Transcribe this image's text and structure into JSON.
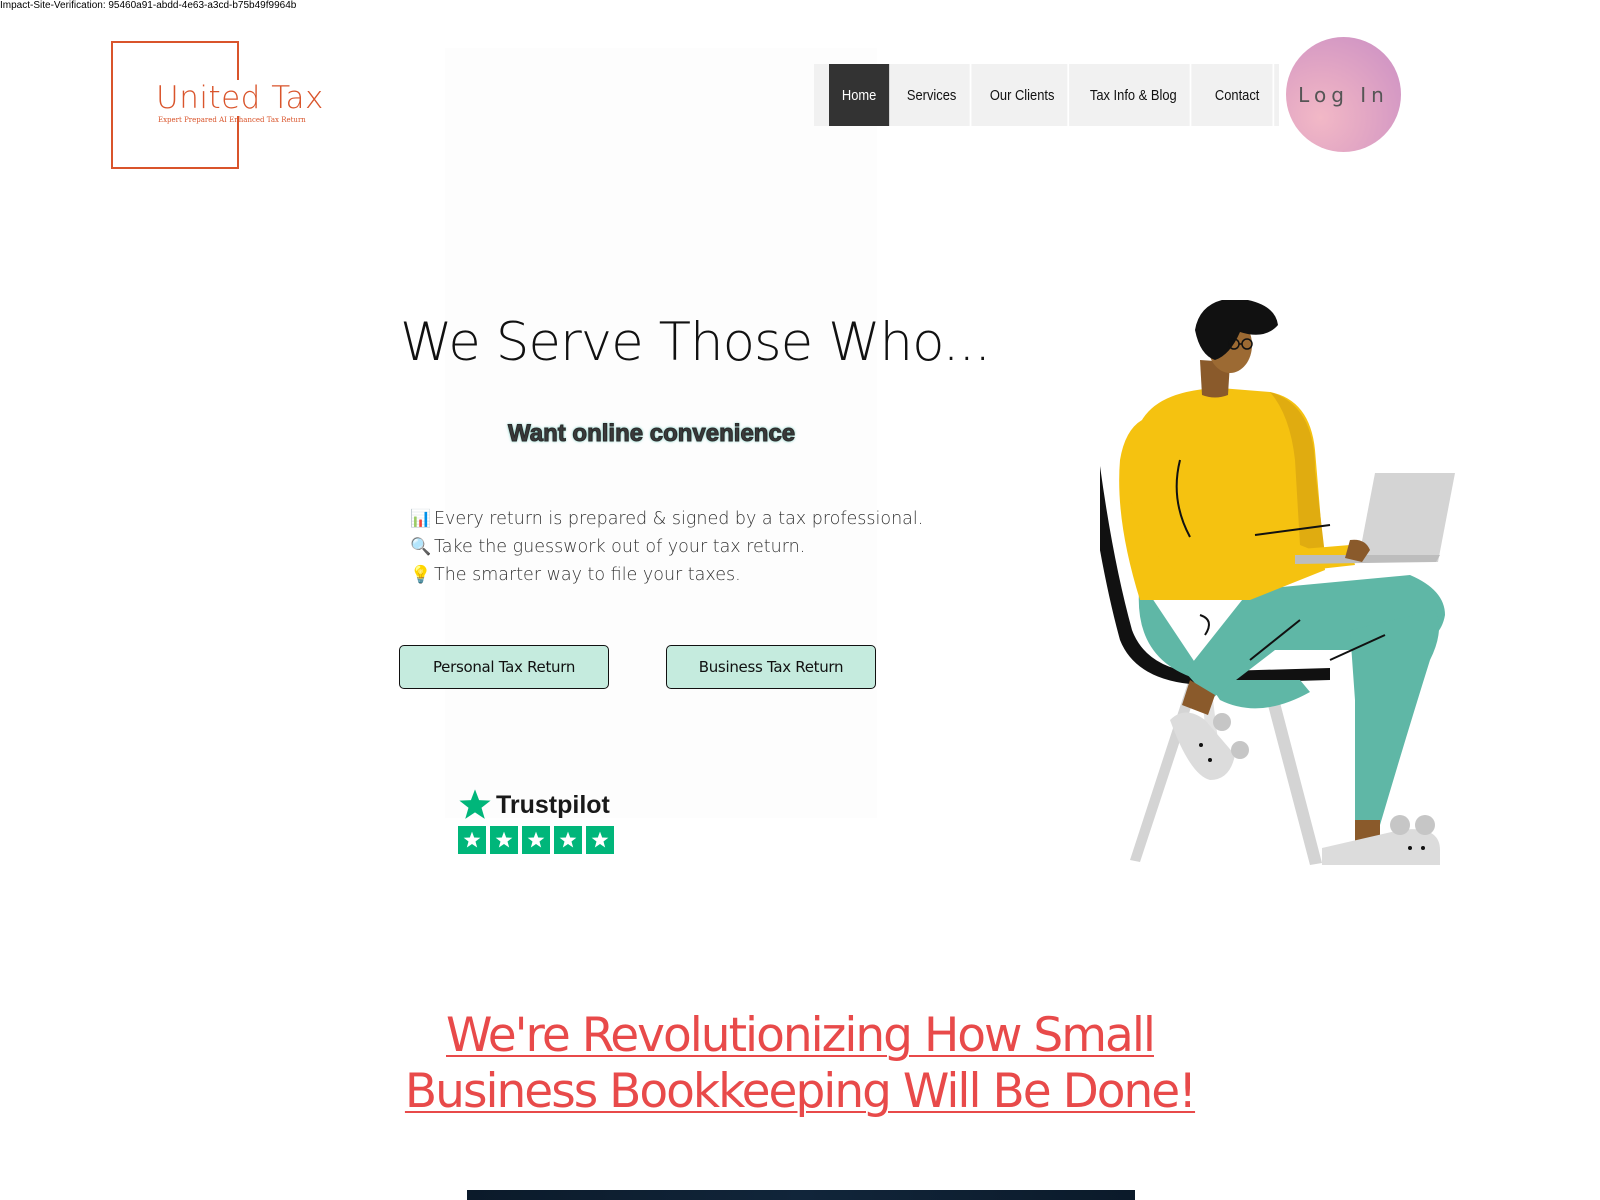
{
  "verification_text": "Impact-Site-Verification: 95460a91-abdd-4e63-a3cd-b75b49f9964b",
  "logo": {
    "title": "United Tax",
    "tagline": "Expert Prepared AI Enhanced Tax Return"
  },
  "nav": {
    "items": [
      {
        "label": "Home",
        "active": true
      },
      {
        "label": "Services"
      },
      {
        "label": "Our Clients"
      },
      {
        "label": "Tax Info & Blog"
      },
      {
        "label": "Contact"
      }
    ]
  },
  "login": {
    "label": "Log In"
  },
  "hero": {
    "title": "We Serve Those Who...",
    "subtitle": "Want online convenience",
    "bullets": [
      {
        "icon": "📊",
        "text": "Every return is prepared & signed by a tax professional."
      },
      {
        "icon": "🔍",
        "text": "Take the guesswork out of your tax return."
      },
      {
        "icon": "💡",
        "text": "The smarter way to file your taxes."
      }
    ],
    "buttons": {
      "personal": "Personal Tax Return",
      "business": "Business Tax Return"
    }
  },
  "trustpilot": {
    "name": "Trustpilot",
    "stars": 5
  },
  "revolution": {
    "line1": "We're Revolutionizing How Small",
    "line2": "Business Bookkeeping Will Be Done!"
  },
  "colors": {
    "brand_orange": "#d9542b",
    "nav_active": "#333333",
    "button_mint": "#c5ebde",
    "headline_red": "#e84a4a",
    "trustpilot_green": "#00b67a"
  }
}
